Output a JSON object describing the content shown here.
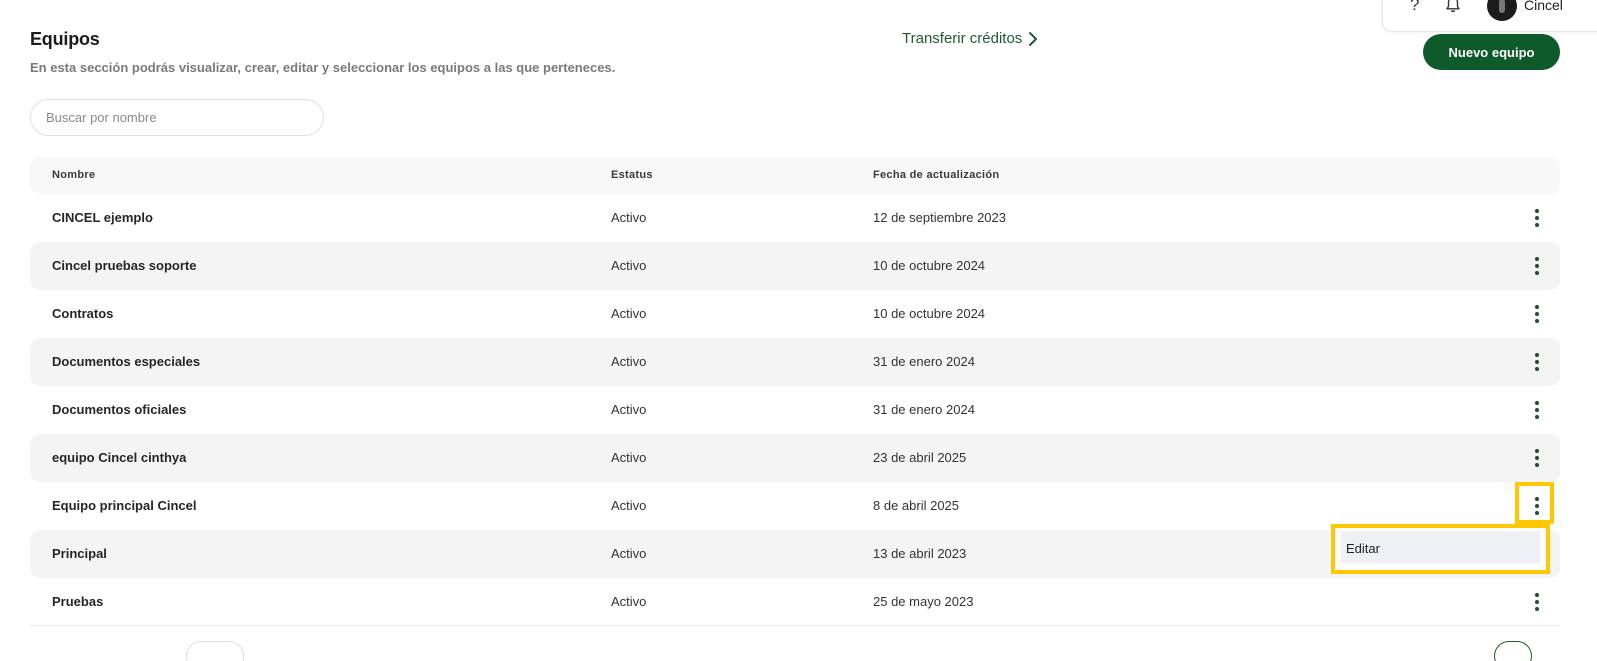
{
  "header": {
    "title": "Equipos",
    "description": "En esta sección podrás visualizar, crear, editar y seleccionar los equipos a las que perteneces.",
    "transfer_label": "Transferir créditos",
    "new_team_label": "Nuevo equipo"
  },
  "topbar": {
    "help_glyph": "?",
    "username": "Cincel"
  },
  "search": {
    "placeholder": "Buscar por nombre",
    "value": ""
  },
  "table": {
    "columns": {
      "name": "Nombre",
      "status": "Estatus",
      "updated": "Fecha de actualización"
    },
    "rows": [
      {
        "name": "CINCEL ejemplo",
        "status": "Activo",
        "updated": "12 de septiembre 2023"
      },
      {
        "name": "Cincel pruebas soporte",
        "status": "Activo",
        "updated": "10 de octubre 2024"
      },
      {
        "name": "Contratos",
        "status": "Activo",
        "updated": "10 de octubre 2024"
      },
      {
        "name": "Documentos especiales",
        "status": "Activo",
        "updated": "31 de enero 2024"
      },
      {
        "name": "Documentos oficiales",
        "status": "Activo",
        "updated": "31 de enero 2024"
      },
      {
        "name": "equipo Cincel cinthya",
        "status": "Activo",
        "updated": "23 de abril 2025"
      },
      {
        "name": "Equipo principal Cincel",
        "status": "Activo",
        "updated": "8 de abril 2025"
      },
      {
        "name": "Principal",
        "status": "Activo",
        "updated": "13 de abril 2023"
      },
      {
        "name": "Pruebas",
        "status": "Activo",
        "updated": "25 de mayo 2023"
      }
    ]
  },
  "context_menu": {
    "edit_label": "Editar"
  },
  "colors": {
    "brand_green": "#0f5a2b",
    "link_green": "#1e5a32",
    "highlight": "#ffc800"
  }
}
